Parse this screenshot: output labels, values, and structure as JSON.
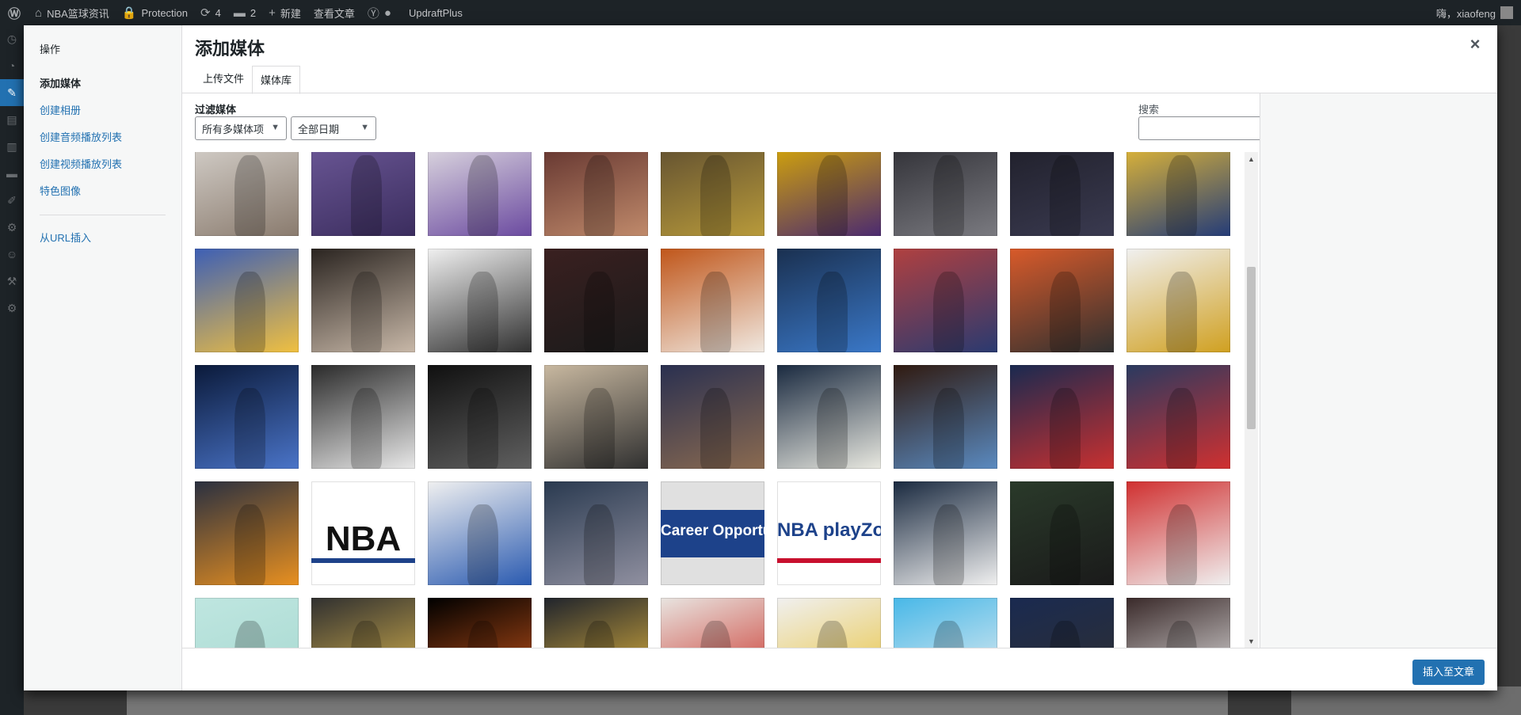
{
  "admin_bar": {
    "site_name": "NBA篮球资讯",
    "protection": "Protection",
    "updates_count": "4",
    "comments_count": "2",
    "new_label": "新建",
    "view_post": "查看文章",
    "updraft": "UpdraftPlus",
    "greeting": "嗨，xiaofeng"
  },
  "modal": {
    "menu": {
      "heading": "操作",
      "items": [
        "添加媒体",
        "创建相册",
        "创建音频播放列表",
        "创建视频播放列表",
        "特色图像"
      ],
      "url_insert": "从URL插入"
    },
    "title": "添加媒体",
    "close_glyph": "×",
    "tabs": [
      "上传文件",
      "媒体库"
    ],
    "filter_label": "过滤媒体",
    "type_filter": "所有多媒体项",
    "date_filter": "全部日期",
    "search_label": "搜索",
    "search_value": "",
    "insert_button": "插入至文章"
  },
  "media_tiles": [
    {
      "c1": "#d9d5d0",
      "c2": "#8a7b6e"
    },
    {
      "c1": "#6e5a9a",
      "c2": "#3b2d5e"
    },
    {
      "c1": "#e8e6e6",
      "c2": "#6b4aa0"
    },
    {
      "c1": "#5b2d2a",
      "c2": "#c08a6b"
    },
    {
      "c1": "#5a4a30",
      "c2": "#b89a3a"
    },
    {
      "c1": "#e0b000",
      "c2": "#4b2a70"
    },
    {
      "c1": "#2a2a30",
      "c2": "#7a7a80"
    },
    {
      "c1": "#1e1e28",
      "c2": "#3a3a50"
    },
    {
      "c1": "#f2c230",
      "c2": "#243c78"
    },
    {
      "c1": "#3d5fb5",
      "c2": "#f0c040"
    },
    {
      "c1": "#2a2420",
      "c2": "#c8b8a8"
    },
    {
      "c1": "#f0f0f0",
      "c2": "#303030"
    },
    {
      "c1": "#3a2020",
      "c2": "#1a1a1a"
    },
    {
      "c1": "#c0561a",
      "c2": "#f0e8e0"
    },
    {
      "c1": "#1a3050",
      "c2": "#3a78c8"
    },
    {
      "c1": "#b04040",
      "c2": "#2a3a70"
    },
    {
      "c1": "#d85a2a",
      "c2": "#303030"
    },
    {
      "c1": "#f0f0f0",
      "c2": "#d0a020"
    },
    {
      "c1": "#0b1a3a",
      "c2": "#4a74c8"
    },
    {
      "c1": "#2a2a2a",
      "c2": "#e8e8e8"
    },
    {
      "c1": "#101010",
      "c2": "#606060"
    },
    {
      "c1": "#c8b8a0",
      "c2": "#303030"
    },
    {
      "c1": "#2a3050",
      "c2": "#8a6a50"
    },
    {
      "c1": "#1a2a40",
      "c2": "#e8e8e0"
    },
    {
      "c1": "#301a10",
      "c2": "#5a8ac0"
    },
    {
      "c1": "#1a2a50",
      "c2": "#c83030"
    },
    {
      "c1": "#2a3a60",
      "c2": "#d03030"
    },
    {
      "c1": "#2a3040",
      "c2": "#e89020"
    },
    {
      "c1": "#ffffff",
      "c2": "#1d428a",
      "text": "NBA",
      "text_color": "#111111"
    },
    {
      "c1": "#f0f0f0",
      "c2": "#2a5ab0"
    },
    {
      "c1": "#2a3a50",
      "c2": "#9090a0"
    },
    {
      "c1": "#e0e0e0",
      "c2": "#1d428a",
      "text": "Career Opportunit",
      "text_color": "#ffffff",
      "band": true
    },
    {
      "c1": "#ffffff",
      "c2": "#c8102e",
      "text": "NBA playZo",
      "text_color": "#1d428a"
    },
    {
      "c1": "#1a2a40",
      "c2": "#f0f0f0"
    },
    {
      "c1": "#2a3a2a",
      "c2": "#1a1a1a"
    },
    {
      "c1": "#d03030",
      "c2": "#f0f0f0"
    },
    {
      "c1": "#bfe6e0",
      "c2": "#a6d8d0"
    },
    {
      "c1": "#303030",
      "c2": "#e8c050"
    },
    {
      "c1": "#000000",
      "c2": "#d0581a"
    },
    {
      "c1": "#20242c",
      "c2": "#f0c040"
    },
    {
      "c1": "#e8e4e0",
      "c2": "#c8281e"
    },
    {
      "c1": "#f0f0f0",
      "c2": "#e8c030"
    },
    {
      "c1": "#48b8e8",
      "c2": "#f0f0f0"
    },
    {
      "c1": "#1a2a50",
      "c2": "#303030"
    },
    {
      "c1": "#3a2a2a",
      "c2": "#f0f0f0"
    }
  ]
}
